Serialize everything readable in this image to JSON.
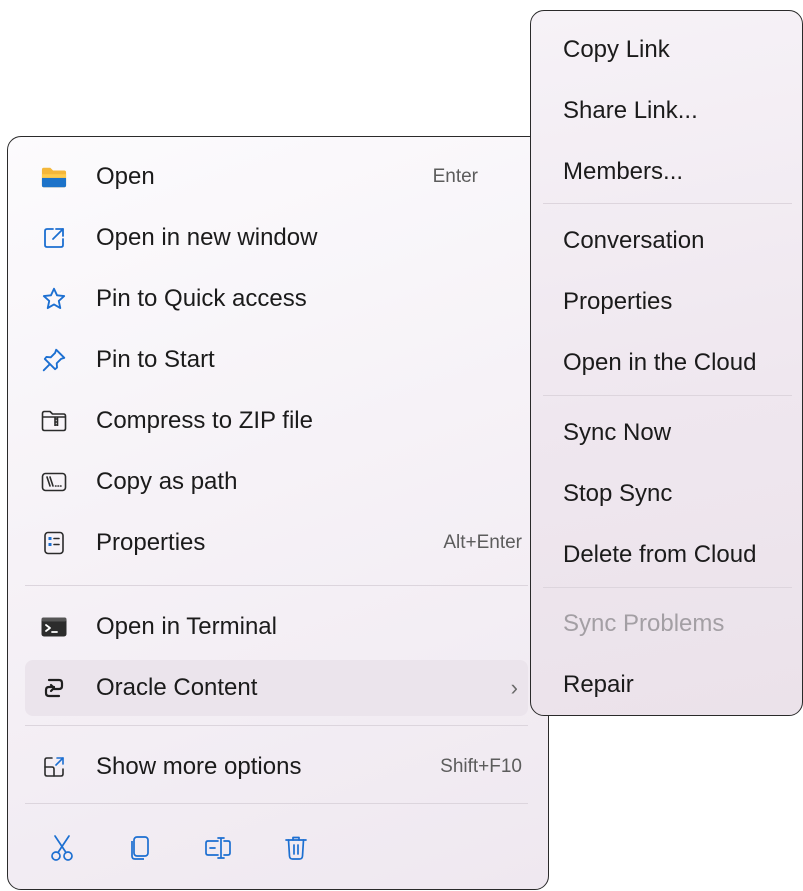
{
  "context_menu": {
    "items": [
      {
        "label": "Open",
        "shortcut": "Enter",
        "icon": "folder-icon"
      },
      {
        "label": "Open in new window",
        "shortcut": "",
        "icon": "open-new-window-icon"
      },
      {
        "label": "Pin to Quick access",
        "shortcut": "",
        "icon": "star-icon"
      },
      {
        "label": "Pin to Start",
        "shortcut": "",
        "icon": "pin-icon"
      },
      {
        "label": "Compress to ZIP file",
        "shortcut": "",
        "icon": "zip-folder-icon"
      },
      {
        "label": "Copy as path",
        "shortcut": "",
        "icon": "path-icon"
      },
      {
        "label": "Properties",
        "shortcut": "Alt+Enter",
        "icon": "properties-icon"
      },
      {
        "label": "Open in Terminal",
        "shortcut": "",
        "icon": "terminal-icon"
      },
      {
        "label": "Oracle Content",
        "shortcut": "",
        "icon": "oracle-content-icon",
        "submenu_arrow": "›"
      },
      {
        "label": "Show more options",
        "shortcut": "Shift+F10",
        "icon": "show-more-icon"
      }
    ],
    "bottom_actions": [
      {
        "name": "cut",
        "icon": "scissors-icon"
      },
      {
        "name": "copy",
        "icon": "copy-icon"
      },
      {
        "name": "rename",
        "icon": "rename-icon"
      },
      {
        "name": "delete",
        "icon": "trash-icon"
      }
    ]
  },
  "oracle_submenu": {
    "items": [
      {
        "label": "Copy Link",
        "disabled": false
      },
      {
        "label": "Share Link...",
        "disabled": false
      },
      {
        "label": "Members...",
        "disabled": false
      },
      {
        "label": "Conversation",
        "disabled": false
      },
      {
        "label": "Properties",
        "disabled": false
      },
      {
        "label": "Open in the Cloud",
        "disabled": false
      },
      {
        "label": "Sync Now",
        "disabled": false
      },
      {
        "label": "Stop Sync",
        "disabled": false
      },
      {
        "label": "Delete from Cloud",
        "disabled": false
      },
      {
        "label": "Sync Problems",
        "disabled": true
      },
      {
        "label": "Repair",
        "disabled": false
      }
    ]
  },
  "colors": {
    "folder_yellow": "#f4b73a",
    "folder_blue": "#1c73c9",
    "icon_blue": "#1c6fd1",
    "icon_dark": "#2b2b2b",
    "disabled_text": "#a39fa4"
  }
}
